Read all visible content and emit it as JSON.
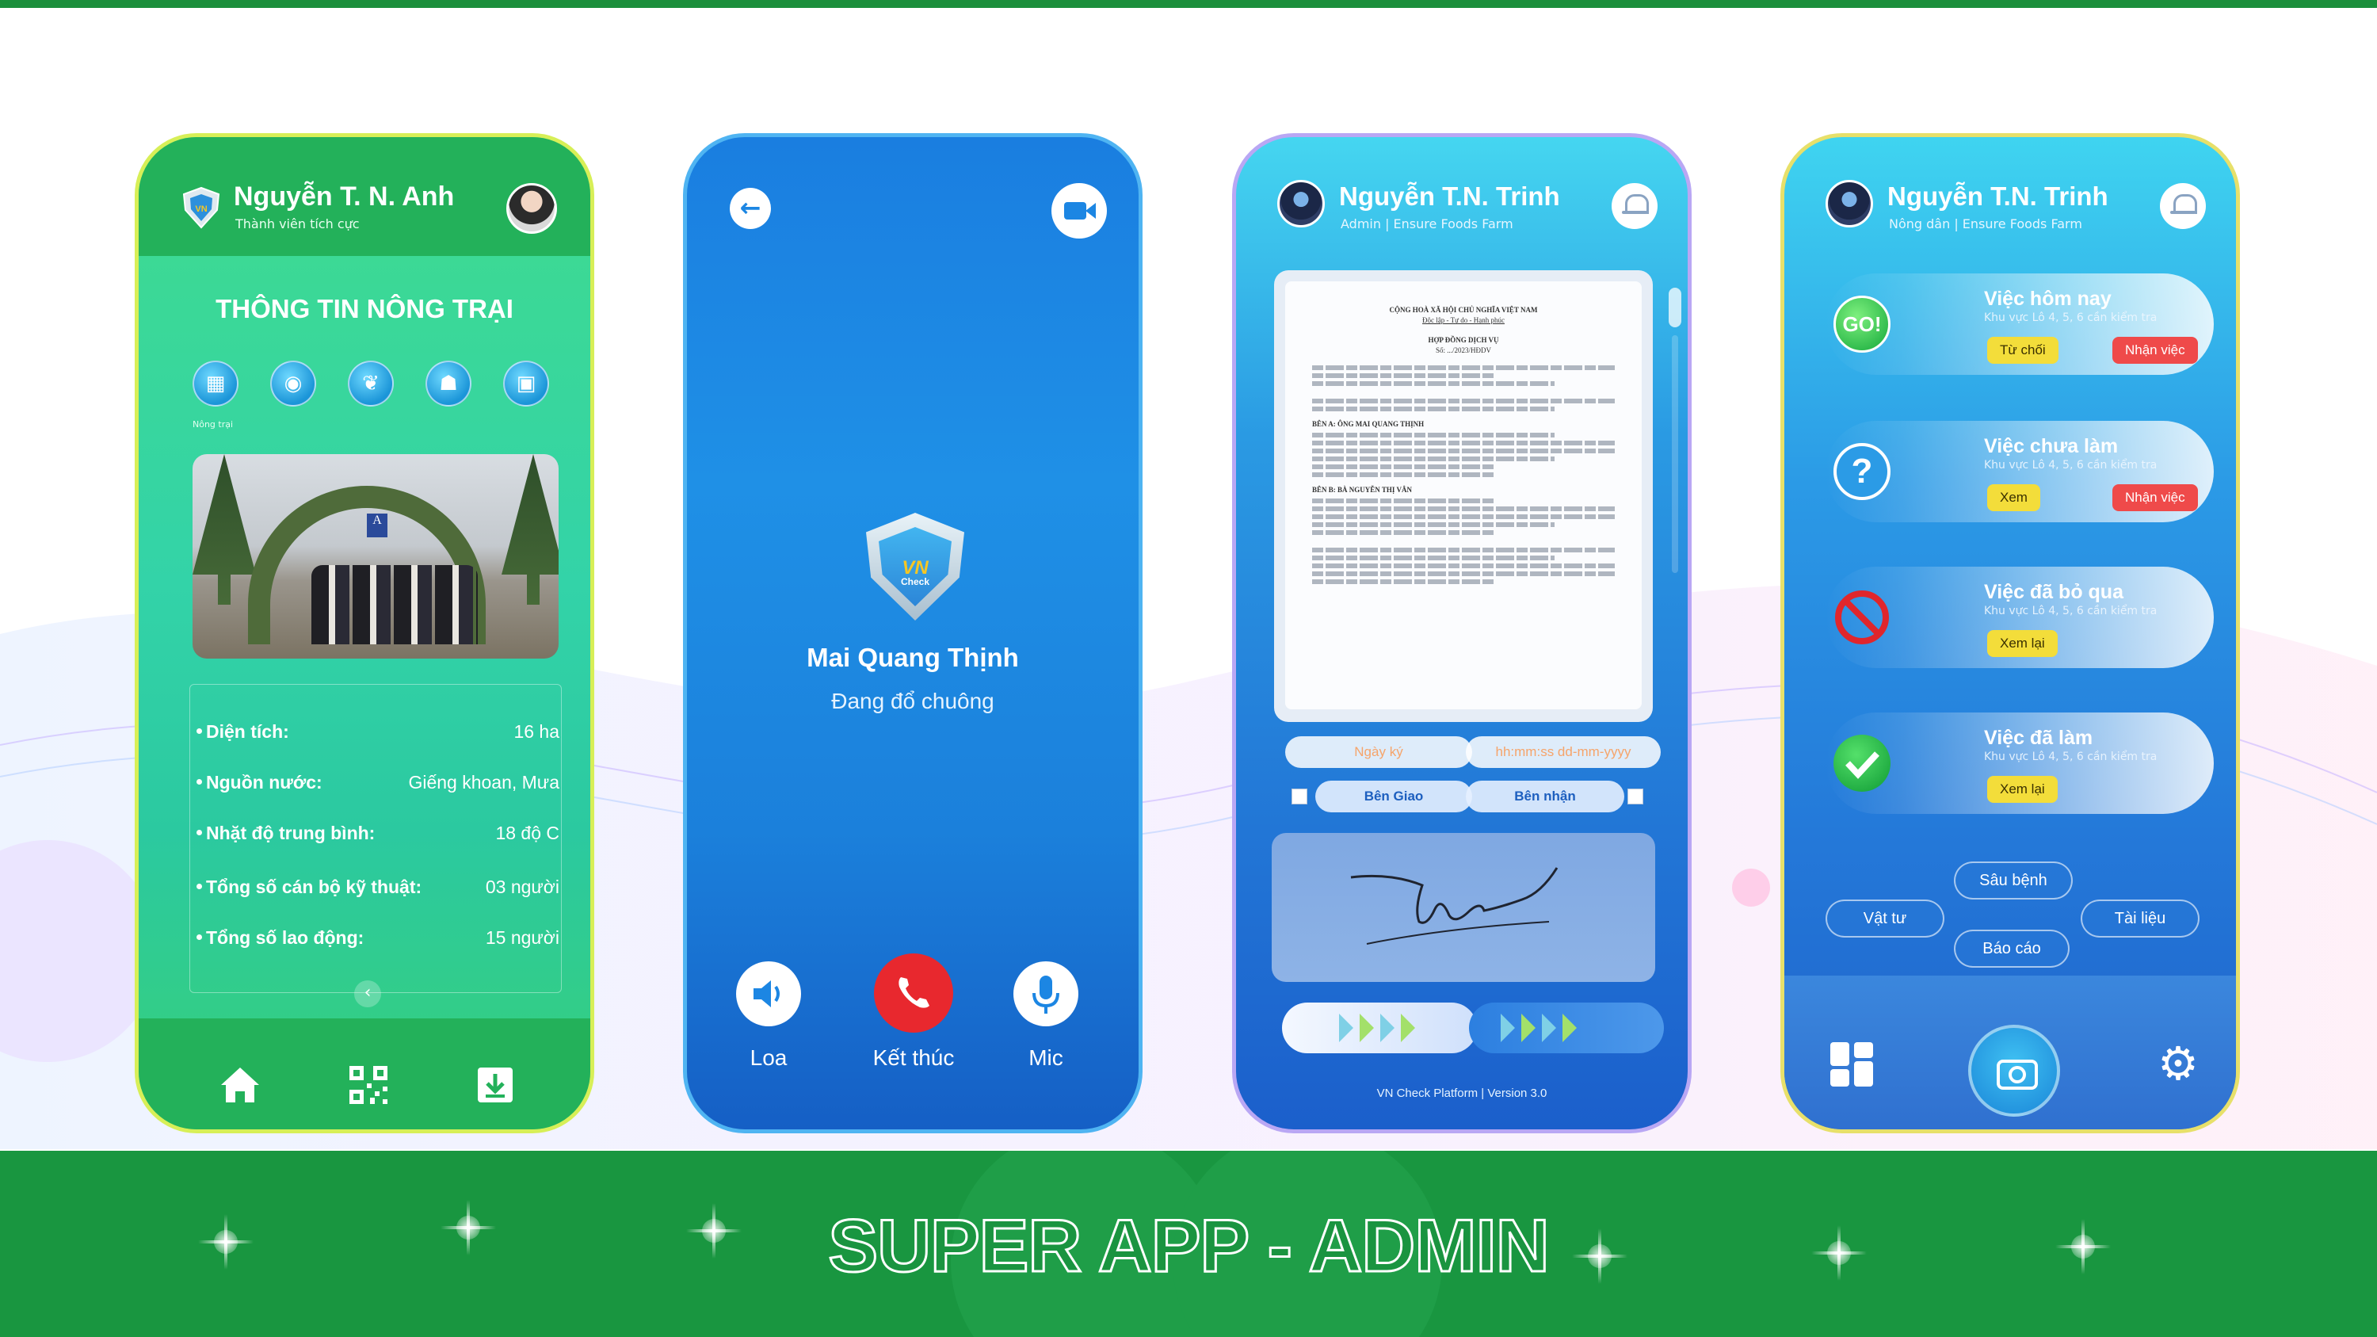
{
  "banner": {
    "title": "SUPER APP - ADMIN"
  },
  "farm_screen": {
    "user_name": "Nguyễn T. N. Anh",
    "user_role": "Thành viên tích cực",
    "section_title": "THÔNG TIN NÔNG TRẠI",
    "category_label": "Nông trại",
    "info": [
      {
        "label": "Diện tích:",
        "value": "16 ha"
      },
      {
        "label": "Nguồn nước:",
        "value": "Giếng khoan, Mưa"
      },
      {
        "label": "Nhặt độ trung bình:",
        "value": "18 độ C"
      },
      {
        "label": "Tổng số cán bộ kỹ thuật:",
        "value": "03 người"
      },
      {
        "label": "Tổng số lao động:",
        "value": "15 người"
      }
    ],
    "photo_sign": "A"
  },
  "call_screen": {
    "logo_text": "VN",
    "logo_sub": "Check",
    "caller_name": "Mai Quang Thịnh",
    "status": "Đang đổ chuông",
    "buttons": {
      "speaker": "Loa",
      "end": "Kết thúc",
      "mic": "Mic"
    }
  },
  "contract_screen": {
    "user_name": "Nguyễn T.N. Trinh",
    "user_role": "Admin | Ensure Foods Farm",
    "document": {
      "header_1": "CỘNG HOÀ XÃ HỘI CHỦ NGHĨA VIỆT NAM",
      "header_2": "Độc lập - Tự do - Hạnh phúc",
      "title": "HỢP ĐỒNG DỊCH VỤ",
      "number": "Số: .../2023/HĐDV",
      "party_a_label": "BÊN A:",
      "party_a_name": "ÔNG MAI QUANG THỊNH",
      "party_b_label": "BÊN B:",
      "party_b_name": "BÀ NGUYỄN THỊ VÂN"
    },
    "date_placeholder_1": "Ngày ký",
    "date_placeholder_2": "hh:mm:ss dd-mm-yyyy",
    "party_giao": "Bên Giao",
    "party_nhan": "Bên nhận",
    "footer": "VN Check Platform   |   Version 3.0"
  },
  "task_screen": {
    "user_name": "Nguyễn T.N. Trinh",
    "user_role": "Nông dân | Ensure Foods Farm",
    "tasks": [
      {
        "title": "Việc hôm nay",
        "sub": "Khu vực Lô 4, 5, 6 cần kiểm tra",
        "btn1": "Từ chối",
        "btn2": "Nhận việc",
        "icon_text": "GO!"
      },
      {
        "title": "Việc chưa làm",
        "sub": "Khu vực Lô 4, 5, 6 cần kiểm tra",
        "btn1": "Xem",
        "btn2": "Nhận việc",
        "icon_text": "?"
      },
      {
        "title": "Việc đã bỏ qua",
        "sub": "Khu vực Lô 4, 5, 6 cần kiểm tra",
        "btn1": "Xem lại"
      },
      {
        "title": "Việc đã làm",
        "sub": "Khu vực Lô 4, 5, 6 cần kiểm tra",
        "btn1": "Xem lại"
      }
    ],
    "chips": {
      "sau_benh": "Sâu bệnh",
      "vat_tu": "Vật tư",
      "tai_lieu": "Tài liệu",
      "bao_cao": "Báo cáo"
    }
  },
  "colors": {
    "brand_green": "#199640",
    "accent_blue": "#1c86e3",
    "end_call_red": "#e8282e",
    "button_yellow": "#f3dd3a"
  }
}
